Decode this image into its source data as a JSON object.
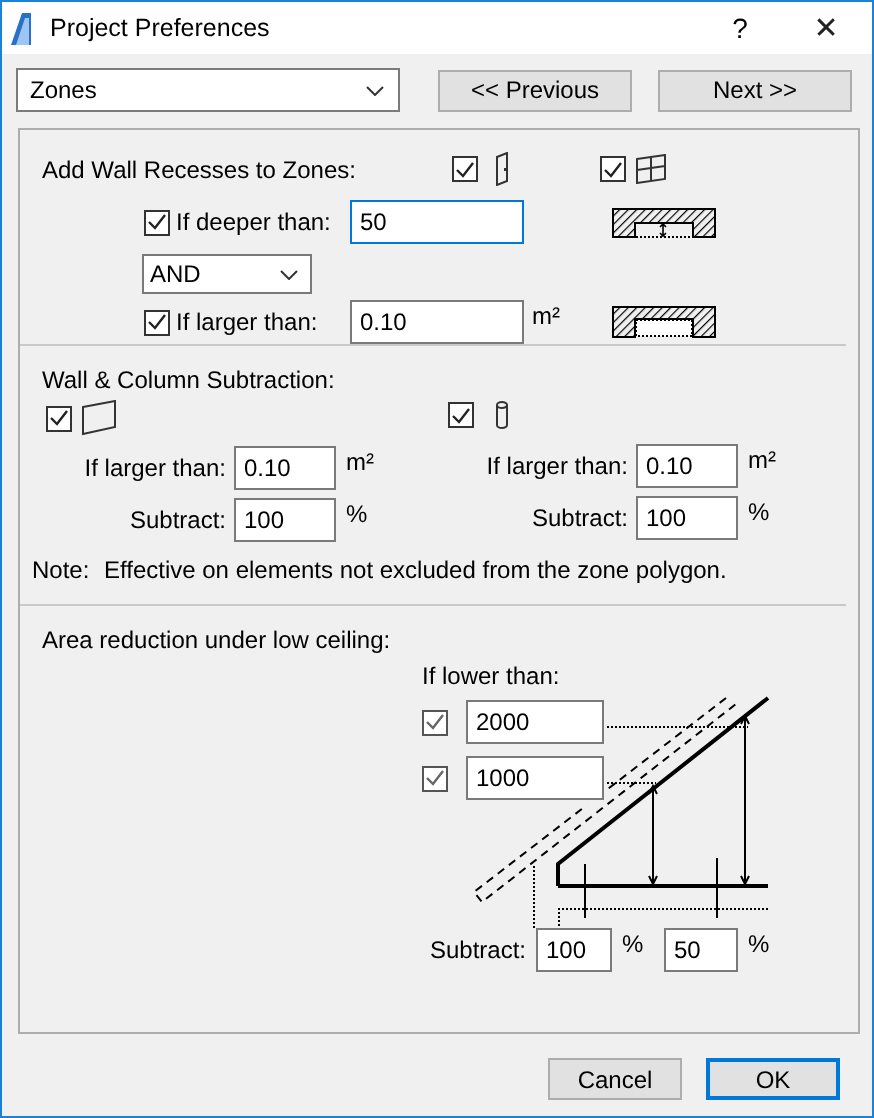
{
  "window": {
    "title": "Project Preferences",
    "help": "?",
    "close": "✕"
  },
  "navigation": {
    "category": "Zones",
    "buttons": [
      {
        "label": "<< Previous"
      },
      {
        "label": "Next >>"
      }
    ]
  },
  "recesses": {
    "title": "Add Wall Recesses to Zones:",
    "element_toggles": [
      {
        "kind": "door",
        "checked": true
      },
      {
        "kind": "window",
        "checked": true
      }
    ],
    "conditions": [
      {
        "kind": "depth",
        "checked": true,
        "label": "If deeper than:",
        "value": "50",
        "focused": true
      },
      {
        "kind": "area",
        "checked": true,
        "label": "If larger than:",
        "value": "0.10",
        "unit": "m²",
        "focused": false
      }
    ],
    "operator": "AND"
  },
  "subtraction": {
    "title": "Wall & Column Subtraction:",
    "groups": [
      {
        "kind": "wall",
        "checked": true,
        "size_label": "If larger than:",
        "size_value": "0.10",
        "size_unit": "m²",
        "subtract_label": "Subtract:",
        "subtract_value": "100",
        "subtract_unit": "%"
      },
      {
        "kind": "column",
        "checked": true,
        "size_label": "If larger than:",
        "size_value": "0.10",
        "size_unit": "m²",
        "subtract_label": "Subtract:",
        "subtract_value": "100",
        "subtract_unit": "%"
      }
    ],
    "note_label": "Note:",
    "note": "Effective on elements not excluded from the zone polygon."
  },
  "low_ceiling": {
    "title": "Area reduction under low ceiling:",
    "heading": "If lower than:",
    "heights": [
      {
        "checked": true,
        "value": "2000"
      },
      {
        "checked": true,
        "value": "1000"
      }
    ],
    "subtract_label": "Subtract:",
    "subtracts": [
      {
        "value": "100",
        "unit": "%"
      },
      {
        "value": "50",
        "unit": "%"
      }
    ]
  },
  "buttons": [
    {
      "label": "Cancel",
      "default": false
    },
    {
      "label": "OK",
      "default": true
    }
  ]
}
